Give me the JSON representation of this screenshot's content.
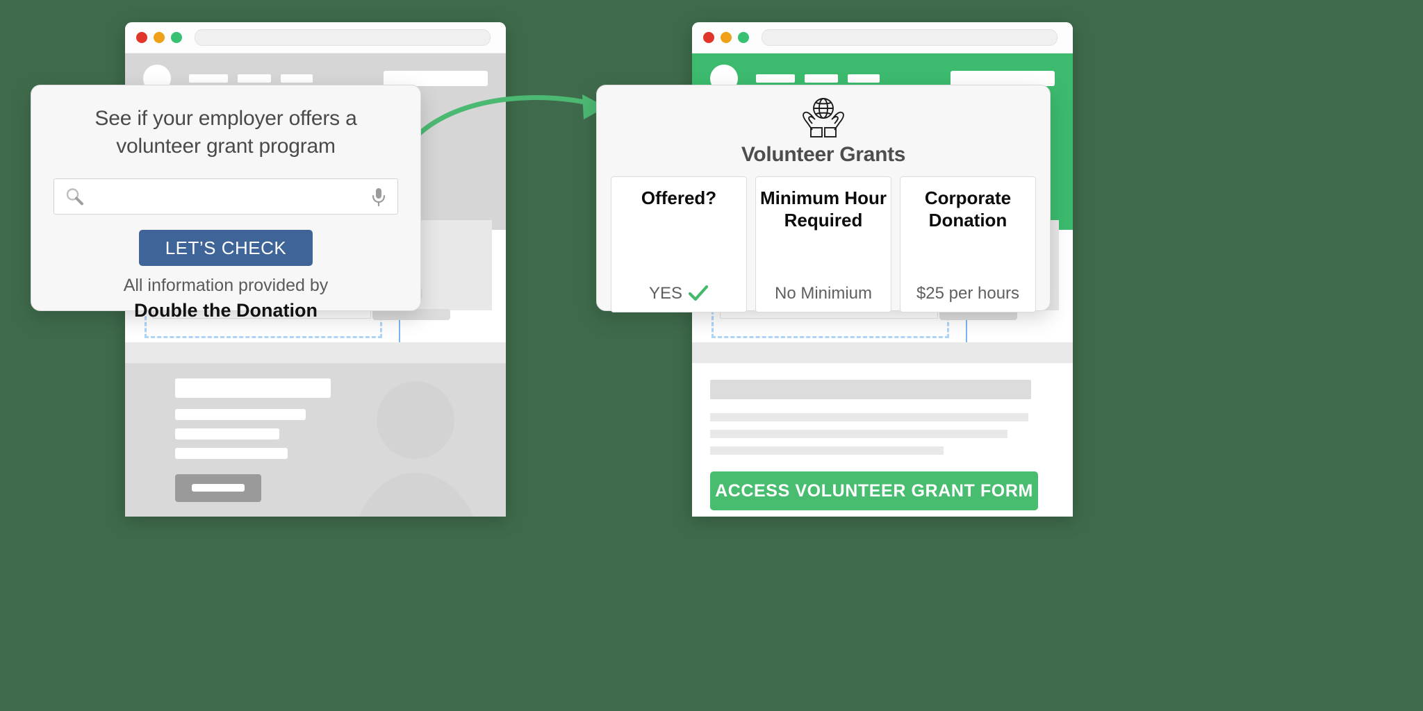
{
  "background_color": "#3f6b4c",
  "accent_colors": {
    "button_blue": "#3e6498",
    "brand_green": "#3cbb6e",
    "cta_green": "#48bd6f",
    "arrow_green": "#4cb973",
    "check_green": "#45b96a"
  },
  "left_browser": {
    "name": "employer-search-browser",
    "traffic_lights": [
      "close-red",
      "minimize-amber",
      "maximize-green"
    ],
    "url_placeholder": "",
    "header_style": "gray"
  },
  "right_browser": {
    "name": "volunteer-grant-results-browser",
    "traffic_lights": [
      "close-red",
      "minimize-amber",
      "maximize-green"
    ],
    "url_placeholder": "",
    "header_style": "green",
    "cta_label": "ACCESS VOLUNTEER GRANT FORM"
  },
  "left_card": {
    "title_line1": "See if your employer offers a",
    "title_line2": "volunteer grant program",
    "search_placeholder": "",
    "search_value": "",
    "search_icon": "magnifier-icon",
    "mic_icon": "microphone-icon",
    "button_label": "LET’S CHECK",
    "footer_text": "All information provided by",
    "brand_text": "Double the Donation"
  },
  "arrow": {
    "name": "flow-arrow",
    "direction": "left-to-right",
    "color": "#4cb973"
  },
  "right_card": {
    "icon": "globe-in-hands-icon",
    "title": "Volunteer Grants",
    "tiles": [
      {
        "heading": "Offered?",
        "value": "YES",
        "value_icon": "green-check-icon"
      },
      {
        "heading": "Minimum Hour Required",
        "value": "No Minimium",
        "value_icon": ""
      },
      {
        "heading": "Corporate Donation",
        "value": "$25 per hours",
        "value_icon": ""
      }
    ]
  }
}
